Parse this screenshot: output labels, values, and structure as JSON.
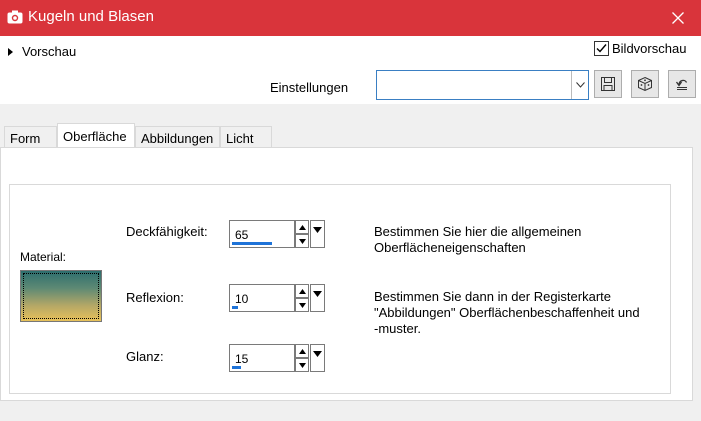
{
  "window": {
    "title": "Kugeln und Blasen"
  },
  "top": {
    "preview_toggle": "Vorschau",
    "bildvorschau": {
      "label": "Bildvorschau",
      "checked": true
    },
    "einstellungen_label": "Einstellungen",
    "einstellungen_value": ""
  },
  "tabs": [
    {
      "label": "Form",
      "active": false
    },
    {
      "label": "Oberfläche",
      "active": true
    },
    {
      "label": "Abbildungen",
      "active": false
    },
    {
      "label": "Licht",
      "active": false
    }
  ],
  "surface": {
    "material_label": "Material:",
    "material_colors": [
      "#2d6e6e",
      "#e8c25a"
    ],
    "params": [
      {
        "label": "Deckfähigkeit:",
        "value": "65",
        "percent": 65
      },
      {
        "label": "Reflexion:",
        "value": "10",
        "percent": 10
      },
      {
        "label": "Glanz:",
        "value": "15",
        "percent": 15
      }
    ],
    "desc1": [
      "Bestimmen Sie hier die allgemeinen",
      "Oberflächeneigenschaften"
    ],
    "desc2": [
      "Bestimmen Sie dann in der Registerkarte",
      "\"Abbildungen\" Oberflächenbeschaffenheit und",
      "-muster."
    ]
  },
  "colors": {
    "titlebar": "#d9343b",
    "accent": "#1e73d8"
  }
}
